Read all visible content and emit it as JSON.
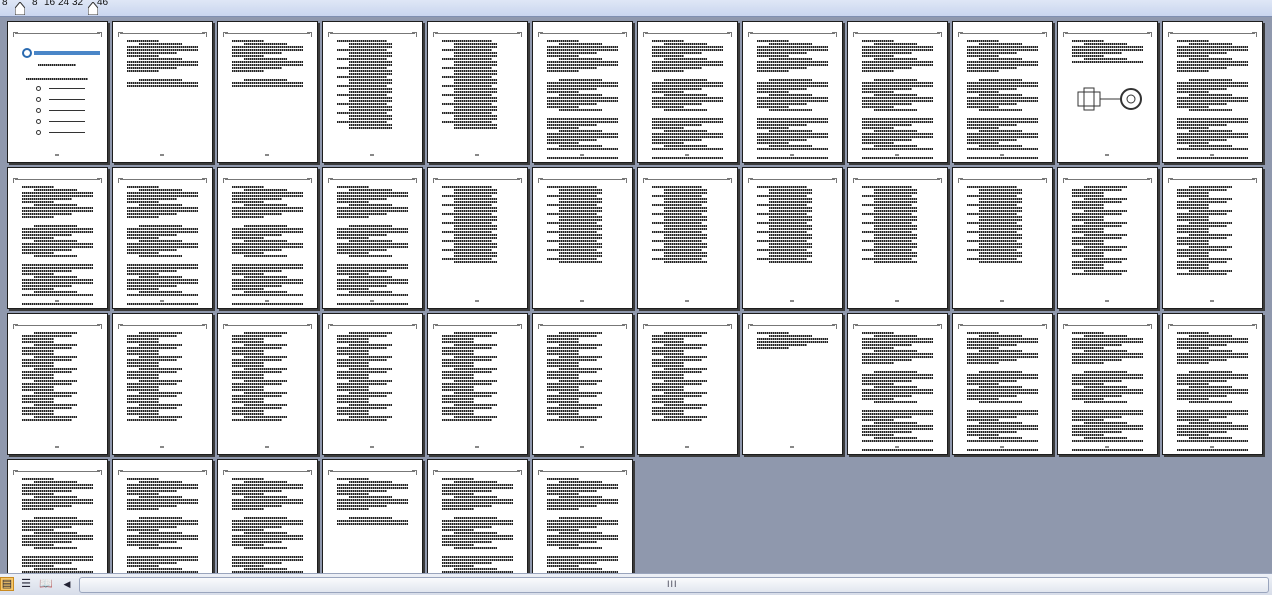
{
  "zoom_ruler": {
    "ticks": [
      "8",
      "8",
      "16",
      "24",
      "32",
      "46"
    ]
  },
  "document": {
    "page_count": 42,
    "cover": {
      "school_name": "长沙航空职业技术学院"
    }
  },
  "statusbar": {
    "views": [
      {
        "name": "thumbnail-view",
        "icon": "grid-icon",
        "active": true
      },
      {
        "name": "outline-view",
        "icon": "list-icon",
        "active": false
      },
      {
        "name": "reading-view",
        "icon": "book-icon",
        "active": false
      }
    ],
    "scroll_left_glyph": "◀",
    "scroll_grip_glyph": "III"
  },
  "colors": {
    "workspace": "#8f98ad",
    "page": "#ffffff",
    "active_view": "#f7c86a"
  }
}
